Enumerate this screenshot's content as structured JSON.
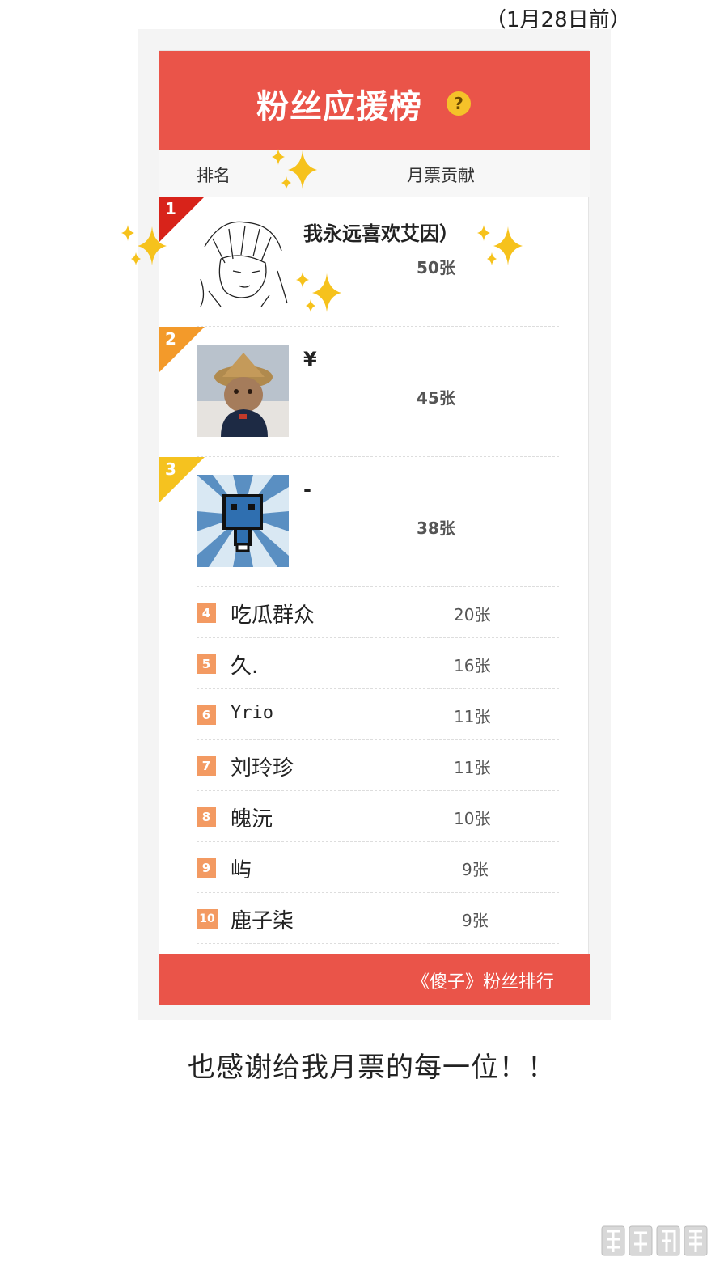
{
  "date_note": "（1月28日前）",
  "panel": {
    "title": "粉丝应援榜",
    "help_glyph": "?",
    "columns": {
      "rank": "排名",
      "votes": "月票贡献"
    },
    "top3": [
      {
        "rank": "1",
        "name": "我永远喜欢艾因）",
        "votes": "50张",
        "ribbon_color": "#d8231a"
      },
      {
        "rank": "2",
        "name": "¥",
        "votes": "45张",
        "ribbon_color": "#f39a2a"
      },
      {
        "rank": "3",
        "name": "-",
        "votes": "38张",
        "ribbon_color": "#f5c21f"
      }
    ],
    "others": [
      {
        "rank": "4",
        "name": "吃瓜群众",
        "votes": "20张"
      },
      {
        "rank": "5",
        "name": "久.",
        "votes": "16张"
      },
      {
        "rank": "6",
        "name": "Yrio",
        "votes": "11张"
      },
      {
        "rank": "7",
        "name": "刘玲珍",
        "votes": "11张"
      },
      {
        "rank": "8",
        "name": "魄沅",
        "votes": "10张"
      },
      {
        "rank": "9",
        "name": "屿",
        "votes": "9张"
      },
      {
        "rank": "10",
        "name": "鹿子柒",
        "votes": "9张"
      }
    ],
    "footer": "《傻子》粉丝排行"
  },
  "thanks": "也感谢给我月票的每一位！！",
  "watermark": "腾讯动漫",
  "colors": {
    "accent": "#ea5449",
    "badge": "#f39a62",
    "help": "#f5c229",
    "sparkle": "#f6c21c"
  }
}
